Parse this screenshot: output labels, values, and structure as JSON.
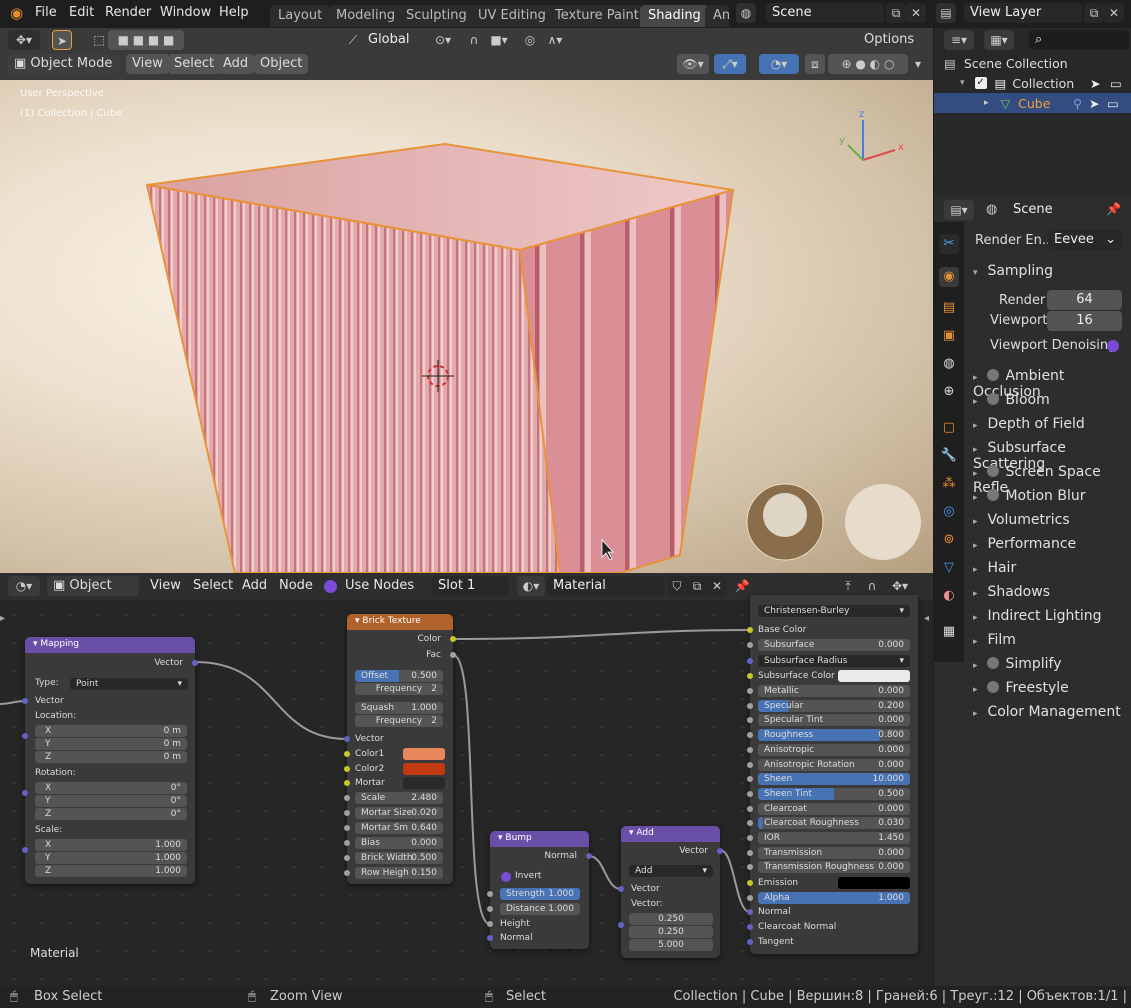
{
  "top_menu": {
    "file": "File",
    "edit": "Edit",
    "render": "Render",
    "window": "Window",
    "help": "Help"
  },
  "workspaces": [
    "Layout",
    "Modeling",
    "Sculpting",
    "UV Editing",
    "Texture Paint",
    "Shading",
    "An"
  ],
  "scene_field": "Scene",
  "view_layer_field": "View Layer",
  "viewport": {
    "mode": "Object Mode",
    "menus": [
      "View",
      "Select",
      "Add",
      "Object"
    ],
    "orientation": "Global",
    "options": "Options",
    "overlay_line1": "User Perspective",
    "overlay_line2": "(1) Collection | Cube",
    "axis_x": "x",
    "axis_y": "y",
    "axis_z": "z"
  },
  "outliner": {
    "scene_collection": "Scene Collection",
    "collection": "Collection",
    "cube": "Cube"
  },
  "properties": {
    "context": "Scene",
    "render_engine_label": "Render En...",
    "render_engine": "Eevee",
    "sampling": "Sampling",
    "render_label": "Render",
    "render_value": "64",
    "viewport_label": "Viewport",
    "viewport_value": "16",
    "viewport_denoising": "Viewport Denoising",
    "sections": [
      {
        "label": "Ambient Occlusion",
        "checkbox": true
      },
      {
        "label": "Bloom",
        "checkbox": true
      },
      {
        "label": "Depth of Field",
        "checkbox": false
      },
      {
        "label": "Subsurface Scattering",
        "checkbox": false
      },
      {
        "label": "Screen Space Refle",
        "checkbox": true
      },
      {
        "label": "Motion Blur",
        "checkbox": true
      },
      {
        "label": "Volumetrics",
        "checkbox": false
      },
      {
        "label": "Performance",
        "checkbox": false
      },
      {
        "label": "Hair",
        "checkbox": false
      },
      {
        "label": "Shadows",
        "checkbox": false
      },
      {
        "label": "Indirect Lighting",
        "checkbox": false
      },
      {
        "label": "Film",
        "checkbox": false
      },
      {
        "label": "Simplify",
        "checkbox": true
      },
      {
        "label": "Freestyle",
        "checkbox": true
      },
      {
        "label": "Color Management",
        "checkbox": false
      }
    ]
  },
  "node_header": {
    "editor_type": "Object",
    "menus": [
      "View",
      "Select",
      "Add",
      "Node"
    ],
    "use_nodes": "Use Nodes",
    "slot": "Slot 1",
    "material": "Material"
  },
  "nodes": {
    "mapping": {
      "title": "Mapping",
      "out_vector": "Vector",
      "type_label": "Type:",
      "type_value": "Point",
      "in_vector": "Vector",
      "location": "Location:",
      "rotation": "Rotation:",
      "scale": "Scale:",
      "loc": [
        {
          "a": "X",
          "v": "0 m"
        },
        {
          "a": "Y",
          "v": "0 m"
        },
        {
          "a": "Z",
          "v": "0 m"
        }
      ],
      "rot": [
        {
          "a": "X",
          "v": "0°"
        },
        {
          "a": "Y",
          "v": "0°"
        },
        {
          "a": "Z",
          "v": "0°"
        }
      ],
      "scl": [
        {
          "a": "X",
          "v": "1.000"
        },
        {
          "a": "Y",
          "v": "1.000"
        },
        {
          "a": "Z",
          "v": "1.000"
        }
      ]
    },
    "brick": {
      "title": "Brick Texture",
      "out_color": "Color",
      "out_fac": "Fac",
      "offset": {
        "l": "Offset",
        "v": "0.500"
      },
      "frequency1": {
        "l": "Frequency",
        "v": "2"
      },
      "squash": {
        "l": "Squash",
        "v": "1.000"
      },
      "frequency2": {
        "l": "Frequency",
        "v": "2"
      },
      "vector": "Vector",
      "color1": "Color1",
      "color2": "Color2",
      "mortar": "Mortar",
      "color1_hex": "#e8875c",
      "color2_hex": "#c23a12",
      "mortar_hex": "#2a2a2a",
      "fields": [
        {
          "l": "Scale",
          "v": "2.480"
        },
        {
          "l": "Mortar Size",
          "v": "0.020"
        },
        {
          "l": "Mortar Sm",
          "v": "0.640"
        },
        {
          "l": "Bias",
          "v": "0.000"
        },
        {
          "l": "Brick Width",
          "v": "0.500"
        },
        {
          "l": "Row Heigh",
          "v": "0.150"
        }
      ]
    },
    "bump": {
      "title": "Bump",
      "out_normal": "Normal",
      "invert": "Invert",
      "strength": {
        "l": "Strength",
        "v": "1.000"
      },
      "distance": {
        "l": "Distance",
        "v": "1.000"
      },
      "height": "Height",
      "normal": "Normal"
    },
    "add": {
      "title": "Add",
      "out_vector": "Vector",
      "op": "Add",
      "in_vector": "Vector",
      "vector_label": "Vector:",
      "values": [
        "0.250",
        "0.250",
        "5.000"
      ]
    },
    "bsdf": {
      "distribution": "Christensen-Burley",
      "base_color": "Base Color",
      "subsurface": {
        "l": "Subsurface",
        "v": "0.000"
      },
      "subsurface_radius": "Subsurface Radius",
      "subsurface_color": "Subsurface Color",
      "fields": [
        {
          "l": "Metallic",
          "v": "0.000",
          "f": 0
        },
        {
          "l": "Specular",
          "v": "0.200",
          "f": 0.2
        },
        {
          "l": "Specular Tint",
          "v": "0.000",
          "f": 0
        },
        {
          "l": "Roughness",
          "v": "0.800",
          "f": 0.8
        },
        {
          "l": "Anisotropic",
          "v": "0.000",
          "f": 0
        },
        {
          "l": "Anisotropic Rotation",
          "v": "0.000",
          "f": 0
        },
        {
          "l": "Sheen",
          "v": "10.000",
          "f": 1
        },
        {
          "l": "Sheen Tint",
          "v": "0.500",
          "f": 0.5
        },
        {
          "l": "Clearcoat",
          "v": "0.000",
          "f": 0
        },
        {
          "l": "Clearcoat Roughness",
          "v": "0.030",
          "f": 0.03
        },
        {
          "l": "IOR",
          "v": "1.450",
          "f": 0
        },
        {
          "l": "Transmission",
          "v": "0.000",
          "f": 0
        },
        {
          "l": "Transmission Roughness",
          "v": "0.000",
          "f": 0
        }
      ],
      "emission": "Emission",
      "alpha": {
        "l": "Alpha",
        "v": "1.000"
      },
      "normal": "Normal",
      "clearcoat_normal": "Clearcoat Normal",
      "tangent": "Tangent"
    },
    "material_label": "Material"
  },
  "status": {
    "box_select": "Box Select",
    "zoom_view": "Zoom View",
    "select": "Select",
    "info": "Collection | Cube | Вершин:8 | Граней:6 | Треуг.:12 | Объектов:1/1 |"
  }
}
